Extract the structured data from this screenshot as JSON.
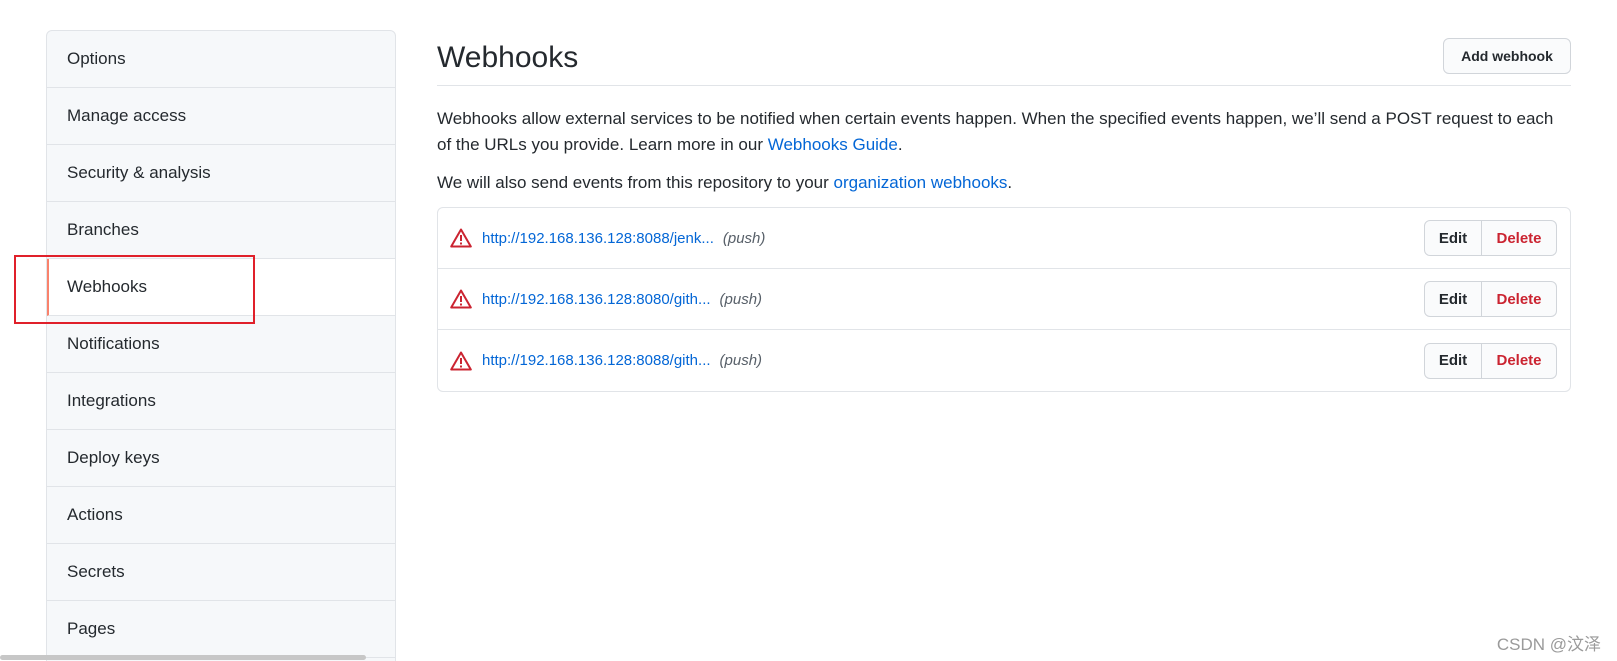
{
  "sidebar": {
    "items": [
      {
        "label": "Options"
      },
      {
        "label": "Manage access"
      },
      {
        "label": "Security & analysis"
      },
      {
        "label": "Branches"
      },
      {
        "label": "Webhooks"
      },
      {
        "label": "Notifications"
      },
      {
        "label": "Integrations"
      },
      {
        "label": "Deploy keys"
      },
      {
        "label": "Actions"
      },
      {
        "label": "Secrets"
      },
      {
        "label": "Pages"
      }
    ],
    "selected": "Webhooks"
  },
  "header": {
    "title": "Webhooks",
    "add_button": "Add webhook"
  },
  "description": {
    "text1": "Webhooks allow external services to be notified when certain events happen. When the specified events happen, we’ll send a POST request to each of the URLs you provide. Learn more in our ",
    "guide_link": "Webhooks Guide",
    "text1_end": ".",
    "text2": "We will also send events from this repository to your ",
    "org_link": "organization webhooks",
    "text2_end": "."
  },
  "webhooks": [
    {
      "url": "http://192.168.136.128:8088/jenk...",
      "event": "(push)",
      "edit": "Edit",
      "delete": "Delete"
    },
    {
      "url": "http://192.168.136.128:8080/gith...",
      "event": "(push)",
      "edit": "Edit",
      "delete": "Delete"
    },
    {
      "url": "http://192.168.136.128:8088/gith...",
      "event": "(push)",
      "edit": "Edit",
      "delete": "Delete"
    }
  ],
  "icons": {
    "warning": "alert-triangle-icon"
  },
  "colors": {
    "link": "#0366d6",
    "danger": "#cb2431",
    "selected_border": "#f9826c",
    "highlight": "#e0202a"
  },
  "watermark": "CSDN @汶泽"
}
